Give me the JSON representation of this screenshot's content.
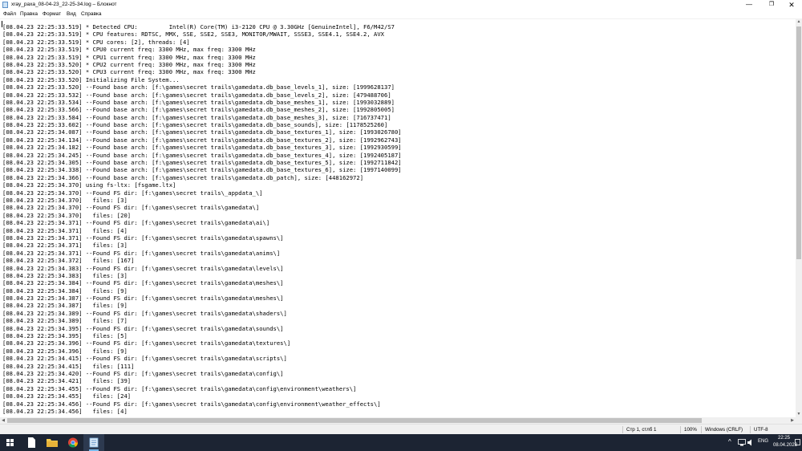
{
  "window": {
    "title": "xray_paxa_08-04-23_22-25-34.log – Блокнот",
    "minimize_glyph": "—",
    "maximize_glyph": "❐",
    "close_glyph": "✕"
  },
  "menu": {
    "items": [
      "Файл",
      "Правка",
      "Формат",
      "Вид",
      "Справка"
    ]
  },
  "editor": {
    "lines": [
      "[08.04.23 22:25:33.519] * Detected CPU:         Intel(R) Core(TM) i3-2120 CPU @ 3.30GHz [GenuineIntel], F6/M42/S7",
      "[08.04.23 22:25:33.519] * CPU features: RDTSC, MMX, SSE, SSE2, SSE3, MONITOR/MWAIT, SSSE3, SSE4.1, SSE4.2, AVX",
      "[08.04.23 22:25:33.519] * CPU cores: [2], threads: [4]",
      "[08.04.23 22:25:33.519] * CPU0 current freq: 3300 MHz, max freq: 3300 MHz",
      "[08.04.23 22:25:33.519] * CPU1 current freq: 3300 MHz, max freq: 3300 MHz",
      "[08.04.23 22:25:33.520] * CPU2 current freq: 3300 MHz, max freq: 3300 MHz",
      "[08.04.23 22:25:33.520] * CPU3 current freq: 3300 MHz, max freq: 3300 MHz",
      "[08.04.23 22:25:33.520] Initializing File System...",
      "[08.04.23 22:25:33.520] --Found base arch: [f:\\games\\secret trails\\gamedata.db_base_levels_1], size: [1999628137]",
      "[08.04.23 22:25:33.532] --Found base arch: [f:\\games\\secret trails\\gamedata.db_base_levels_2], size: [479488706]",
      "[08.04.23 22:25:33.534] --Found base arch: [f:\\games\\secret trails\\gamedata.db_base_meshes_1], size: [1993032889]",
      "[08.04.23 22:25:33.566] --Found base arch: [f:\\games\\secret trails\\gamedata.db_base_meshes_2], size: [1992805005]",
      "[08.04.23 22:25:33.584] --Found base arch: [f:\\games\\secret trails\\gamedata.db_base_meshes_3], size: [716737471]",
      "[08.04.23 22:25:33.602] --Found base arch: [f:\\games\\secret trails\\gamedata.db_base_sounds], size: [1178525260]",
      "[08.04.23 22:25:34.087] --Found base arch: [f:\\games\\secret trails\\gamedata.db_base_textures_1], size: [1993026780]",
      "[08.04.23 22:25:34.134] --Found base arch: [f:\\games\\secret trails\\gamedata.db_base_textures_2], size: [1992962743]",
      "[08.04.23 22:25:34.182] --Found base arch: [f:\\games\\secret trails\\gamedata.db_base_textures_3], size: [1992930599]",
      "[08.04.23 22:25:34.245] --Found base arch: [f:\\games\\secret trails\\gamedata.db_base_textures_4], size: [1992405187]",
      "[08.04.23 22:25:34.305] --Found base arch: [f:\\games\\secret trails\\gamedata.db_base_textures_5], size: [1992711842]",
      "[08.04.23 22:25:34.338] --Found base arch: [f:\\games\\secret trails\\gamedata.db_base_textures_6], size: [1997140099]",
      "[08.04.23 22:25:34.366] --Found base arch: [f:\\games\\secret trails\\gamedata.db_patch], size: [448162972]",
      "[08.04.23 22:25:34.370] using fs-ltx: [fsgame.ltx]",
      "[08.04.23 22:25:34.370] --Found FS dir: [f:\\games\\secret trails\\_appdata_\\]",
      "[08.04.23 22:25:34.370]   files: [3]",
      "[08.04.23 22:25:34.370] --Found FS dir: [f:\\games\\secret trails\\gamedata\\]",
      "[08.04.23 22:25:34.370]   files: [20]",
      "[08.04.23 22:25:34.371] --Found FS dir: [f:\\games\\secret trails\\gamedata\\ai\\]",
      "[08.04.23 22:25:34.371]   files: [4]",
      "[08.04.23 22:25:34.371] --Found FS dir: [f:\\games\\secret trails\\gamedata\\spawns\\]",
      "[08.04.23 22:25:34.371]   files: [3]",
      "[08.04.23 22:25:34.371] --Found FS dir: [f:\\games\\secret trails\\gamedata\\anims\\]",
      "[08.04.23 22:25:34.372]   files: [167]",
      "[08.04.23 22:25:34.383] --Found FS dir: [f:\\games\\secret trails\\gamedata\\levels\\]",
      "[08.04.23 22:25:34.383]   files: [3]",
      "[08.04.23 22:25:34.384] --Found FS dir: [f:\\games\\secret trails\\gamedata\\meshes\\]",
      "[08.04.23 22:25:34.384]   files: [9]",
      "[08.04.23 22:25:34.387] --Found FS dir: [f:\\games\\secret trails\\gamedata\\meshes\\]",
      "[08.04.23 22:25:34.387]   files: [9]",
      "[08.04.23 22:25:34.389] --Found FS dir: [f:\\games\\secret trails\\gamedata\\shaders\\]",
      "[08.04.23 22:25:34.389]   files: [7]",
      "[08.04.23 22:25:34.395] --Found FS dir: [f:\\games\\secret trails\\gamedata\\sounds\\]",
      "[08.04.23 22:25:34.395]   files: [5]",
      "[08.04.23 22:25:34.396] --Found FS dir: [f:\\games\\secret trails\\gamedata\\textures\\]",
      "[08.04.23 22:25:34.396]   files: [9]",
      "[08.04.23 22:25:34.415] --Found FS dir: [f:\\games\\secret trails\\gamedata\\scripts\\]",
      "[08.04.23 22:25:34.415]   files: [111]",
      "[08.04.23 22:25:34.420] --Found FS dir: [f:\\games\\secret trails\\gamedata\\config\\]",
      "[08.04.23 22:25:34.421]   files: [39]",
      "[08.04.23 22:25:34.455] --Found FS dir: [f:\\games\\secret trails\\gamedata\\config\\environment\\weathers\\]",
      "[08.04.23 22:25:34.455]   files: [24]",
      "[08.04.23 22:25:34.456] --Found FS dir: [f:\\games\\secret trails\\gamedata\\config\\environment\\weather_effects\\]",
      "[08.04.23 22:25:34.456]   files: [4]"
    ]
  },
  "status": {
    "position": "Стр 1, стлб 1",
    "zoom": "100%",
    "line_ending": "Windows (CRLF)",
    "encoding": "UTF-8"
  },
  "taskbar": {
    "language": "ENG",
    "time": "22:25",
    "date": "08.04.2023",
    "tray_chevron": "^"
  }
}
